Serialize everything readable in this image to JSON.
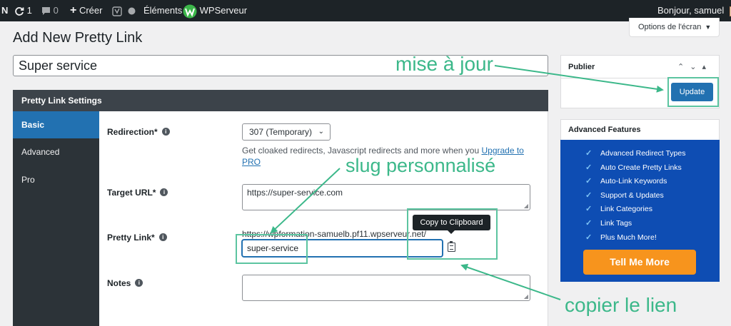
{
  "adminbar": {
    "n": "N",
    "updates": "1",
    "comments": "0",
    "new": "Créer",
    "elements": "Éléments",
    "wpserveur": "WPServeur",
    "greeting": "Bonjour, samuel"
  },
  "page": {
    "title": "Add New Pretty Link",
    "screen_options": "Options de l'écran"
  },
  "title_input": {
    "value": "Super service"
  },
  "settings": {
    "header": "Pretty Link Settings",
    "tabs": [
      "Basic",
      "Advanced",
      "Pro"
    ],
    "active_tab": "Basic",
    "redirection": {
      "label": "Redirection*",
      "value": "307 (Temporary)",
      "upgrade_text": "Get cloaked redirects, Javascript redirects and more when you ",
      "upgrade_link": "Upgrade to PRO"
    },
    "target_url": {
      "label": "Target URL*",
      "value": "https://super-service.com"
    },
    "pretty_link": {
      "label": "Pretty Link*",
      "prefix": "https://wpformation-samuelb.pf11.wpserveur.net/",
      "slug": "super-service",
      "tooltip": "Copy to Clipboard"
    },
    "notes": {
      "label": "Notes",
      "value": ""
    }
  },
  "publish": {
    "title": "Publier",
    "update": "Update"
  },
  "advanced_features": {
    "title": "Advanced Features",
    "items": [
      "Advanced Redirect Types",
      "Auto Create Pretty Links",
      "Auto-Link Keywords",
      "Support & Updates",
      "Link Categories",
      "Link Tags",
      "Plus Much More!"
    ],
    "cta": "Tell Me More"
  },
  "annotations": {
    "update": "mise à jour",
    "slug": "slug personnalisé",
    "copy": "copier le lien"
  },
  "colors": {
    "admin_bar": "#1d2327",
    "accent": "#2271b1",
    "annotation": "#3cb88a",
    "promo_blue": "#0e4db3",
    "cta_orange": "#f7941d"
  }
}
